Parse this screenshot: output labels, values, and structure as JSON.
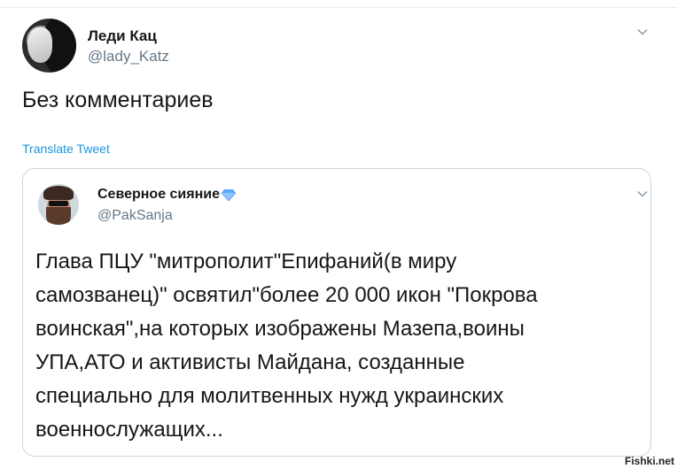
{
  "tweet": {
    "author_name": "Леди Кац",
    "author_handle": "@lady_Katz",
    "text": "Без комментариев",
    "translate_label": "Translate Tweet"
  },
  "quoted_tweet": {
    "author_name": "Северное сияние",
    "author_handle": "@PakSanja",
    "badge_icon": "gem-icon",
    "lines": [
      "Глава ПЦУ \"митрополит\"Епифаний(в миру",
      "самозванец)\" освятил\"более 20 000 икон \"Покрова",
      "воинская\",на которых изображены Мазепа,воины",
      "УПА,АТО и активисты Майдана, созданные",
      "специально для молитвенных нужд украинских",
      "военнослужащих..."
    ]
  },
  "watermark": "Fishki.net",
  "colors": {
    "link": "#1b95e0",
    "secondary_text": "#657786",
    "border": "#ccd6dd",
    "badge": "#5aa8ff"
  }
}
